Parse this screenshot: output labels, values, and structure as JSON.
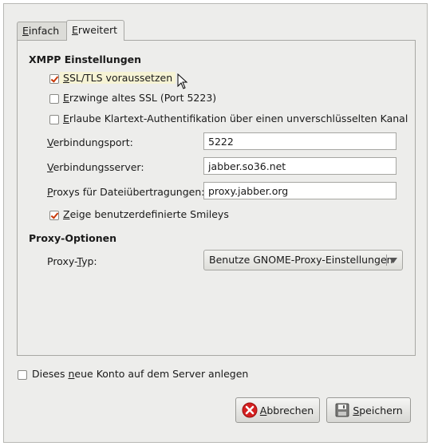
{
  "tabs": [
    {
      "label": "Einfach",
      "mnemonic": "E",
      "rest": "infach",
      "active": false
    },
    {
      "label": "Erweitert",
      "mnemonic": "E",
      "rest": "rweitert",
      "active": true
    }
  ],
  "xmpp": {
    "heading": "XMPP Einstellungen",
    "require_ssl": {
      "mn": "S",
      "rest": "SL/TLS voraussetzen",
      "checked": true
    },
    "force_old_ssl": {
      "mn": "E",
      "rest": "rzwinge altes SSL (Port 5223)",
      "checked": false
    },
    "allow_plaintext": {
      "mn": "E",
      "rest": "rlaube Klartext-Authentifikation über einen unverschlüsselten Kanal",
      "checked": false
    },
    "port": {
      "mn": "V",
      "rest": "erbindungsport:",
      "value": "5222"
    },
    "server": {
      "mn": "V",
      "rest": "erbindungsserver:",
      "value": "jabber.so36.net"
    },
    "proxies": {
      "pre": "",
      "mn": "P",
      "rest": "roxys für Dateiübertragungen:",
      "value": "proxy.jabber.org"
    },
    "smileys": {
      "mn": "Z",
      "rest": "eige benutzerdefinierte Smileys",
      "checked": true
    }
  },
  "proxy": {
    "heading": "Proxy-Optionen",
    "type_pre": "Proxy-",
    "type_mn": "T",
    "type_rest": "yp:",
    "selected": "Benutze GNOME-Proxy-Einstellungen"
  },
  "register": {
    "pre": "Dieses ",
    "mn": "n",
    "rest": "eue Konto auf dem Server anlegen",
    "checked": false
  },
  "buttons": {
    "cancel": {
      "mn": "A",
      "rest": "bbrechen"
    },
    "save": {
      "mn": "S",
      "rest": "peichern"
    }
  },
  "colors": {
    "check_mark": "#c83808",
    "cancel_icon": "#d42020"
  }
}
